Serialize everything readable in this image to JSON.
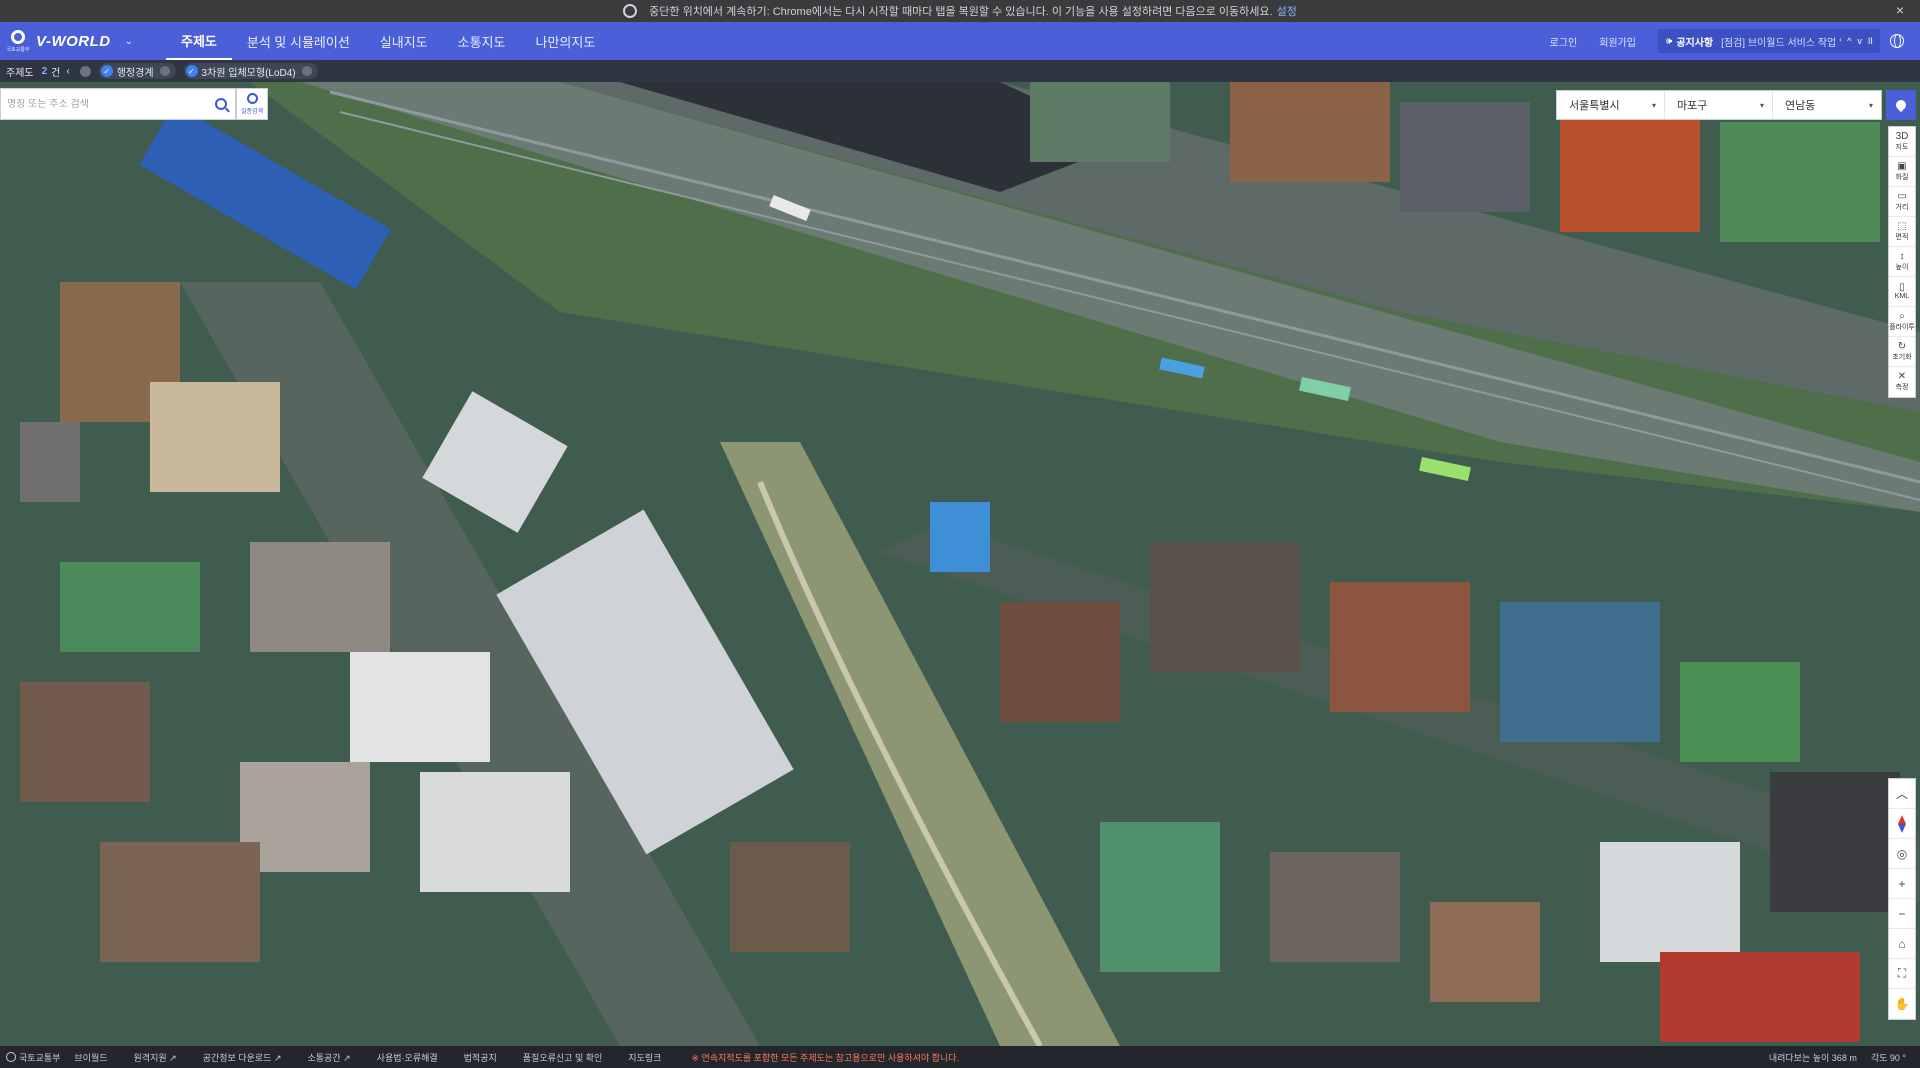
{
  "chrome_notice": {
    "message": "중단한 위치에서 계속하기: Chrome에서는 다시 시작할 때마다 탭을 복원할 수 있습니다. 이 기능을 사용 설정하려면 다음으로 이동하세요.",
    "link": "설정",
    "close": "×"
  },
  "nav": {
    "logo_small": "국토교통부",
    "logo_text": "V-WORLD",
    "menu": [
      {
        "label": "주제도",
        "active": true
      },
      {
        "label": "분석 및 시뮬레이션",
        "active": false
      },
      {
        "label": "실내지도",
        "active": false
      },
      {
        "label": "소통지도",
        "active": false
      },
      {
        "label": "나만의지도",
        "active": false
      }
    ],
    "login": "로그인",
    "signup": "회원가입",
    "notice_title": "공지사항",
    "notice_msg": "[점검] 브이월드 서비스 작업 일정 ···",
    "notice_ctrls": [
      "^",
      "v",
      "II"
    ]
  },
  "filterbar": {
    "label": "주제도",
    "count": "2",
    "unit": "건",
    "prev": "‹",
    "chips": [
      "행정경계",
      "3차원 입체모형(LoD4)"
    ]
  },
  "search": {
    "placeholder": "명칭 또는 주소 검색",
    "voice_label": "실종검색"
  },
  "region": {
    "sido": "서울특별시",
    "sigungu": "마포구",
    "dong": "연남동"
  },
  "tools": [
    {
      "glyph": "3D",
      "label": "지도"
    },
    {
      "glyph": "▣",
      "label": "화질"
    },
    {
      "glyph": "▭",
      "label": "거리"
    },
    {
      "glyph": "⬚",
      "label": "면적"
    },
    {
      "glyph": "↕",
      "label": "높이"
    },
    {
      "glyph": "▯",
      "label": "KML"
    },
    {
      "glyph": "⌕",
      "label": "플라이투"
    },
    {
      "glyph": "↻",
      "label": "초기화"
    },
    {
      "glyph": "✕",
      "label": "측정"
    }
  ],
  "zoom_controls": [
    "︿",
    "",
    "◎",
    "+",
    "−",
    "⌂",
    "⛶",
    "✋"
  ],
  "footer": {
    "ministry": "국토교통부",
    "brand": "브이월드",
    "links": [
      "원격지원 ↗",
      "공간정보 다운로드 ↗",
      "소통공간 ↗",
      "사용법·오류해결",
      "법적공지",
      "품질오류신고 및 확인",
      "지도링크"
    ],
    "warning": "※ 연속지적도를 포함한 모든 주제도는 참고용으로만 사용하셔야 합니다.",
    "altitude": "내려다보는 높이 368 m",
    "angle": "각도 90 °"
  },
  "colors": {
    "nav": "#4a5fd8",
    "accent": "#3b57d6"
  }
}
